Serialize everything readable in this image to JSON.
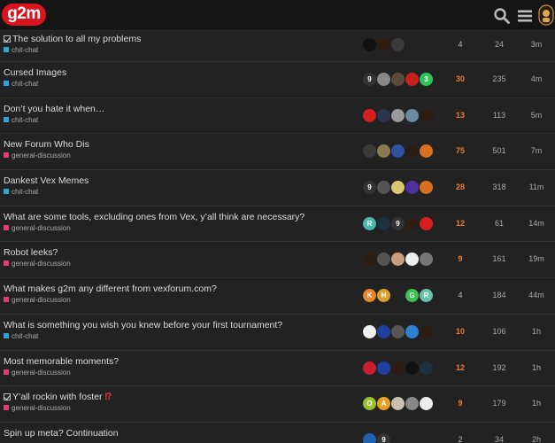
{
  "header": {
    "logo": "g2m",
    "icons": [
      "search-icon",
      "hamburger-menu-icon",
      "user-avatar"
    ]
  },
  "colors": {
    "chit_chat": "#2ea4d8",
    "general_discussion": "#e33a78",
    "hot_replies": "#f07c2e",
    "logo_red": "#d8141f"
  },
  "topics": [
    {
      "title": "The solution to all my problems",
      "pinned": true,
      "emoji": "",
      "category": "chit-chat",
      "cat_color": "#2ea4d8",
      "posters": [
        {
          "bg": "#111",
          "t": ""
        },
        {
          "bg": "#2b1d12",
          "t": ""
        },
        {
          "bg": "#3a3a3a",
          "t": ""
        }
      ],
      "replies": "4",
      "hot": false,
      "views": "24",
      "activity": "3m"
    },
    {
      "title": "Cursed Images",
      "pinned": false,
      "emoji": "",
      "category": "chit-chat",
      "cat_color": "#2ea4d8",
      "posters": [
        {
          "bg": "#333",
          "t": "9"
        },
        {
          "bg": "#888",
          "t": ""
        },
        {
          "bg": "#5b4a3a",
          "t": ""
        },
        {
          "bg": "#c82020",
          "t": ""
        },
        {
          "bg": "#2fc45a",
          "t": "3"
        }
      ],
      "replies": "30",
      "hot": true,
      "views": "235",
      "activity": "4m"
    },
    {
      "title": "Don’t you hate it when…",
      "pinned": false,
      "emoji": "",
      "category": "chit-chat",
      "cat_color": "#2ea4d8",
      "posters": [
        {
          "bg": "#d62020",
          "t": ""
        },
        {
          "bg": "#2a3550",
          "t": ""
        },
        {
          "bg": "#999",
          "t": ""
        },
        {
          "bg": "#6a8aa0",
          "t": ""
        },
        {
          "bg": "#2b1d12",
          "t": ""
        }
      ],
      "replies": "13",
      "hot": true,
      "views": "113",
      "activity": "5m"
    },
    {
      "title": "New Forum Who Dis",
      "pinned": false,
      "emoji": "",
      "category": "general-discussion",
      "cat_color": "#e33a78",
      "posters": [
        {
          "bg": "#3a3a3a",
          "t": ""
        },
        {
          "bg": "#8a7a50",
          "t": ""
        },
        {
          "bg": "#3050a0",
          "t": ""
        },
        {
          "bg": "#2b1d12",
          "t": ""
        },
        {
          "bg": "#d87020",
          "t": ""
        }
      ],
      "replies": "75",
      "hot": true,
      "views": "501",
      "activity": "7m"
    },
    {
      "title": "Dankest Vex Memes",
      "pinned": false,
      "emoji": "",
      "category": "chit-chat",
      "cat_color": "#2ea4d8",
      "posters": [
        {
          "bg": "#333",
          "t": "9"
        },
        {
          "bg": "#555",
          "t": ""
        },
        {
          "bg": "#d8c870",
          "t": ""
        },
        {
          "bg": "#5030a0",
          "t": ""
        },
        {
          "bg": "#d87020",
          "t": ""
        }
      ],
      "replies": "28",
      "hot": true,
      "views": "318",
      "activity": "11m"
    },
    {
      "title": "What are some tools, excluding ones from Vex, y’all think are necessary?",
      "pinned": false,
      "emoji": "",
      "category": "general-discussion",
      "cat_color": "#e33a78",
      "posters": [
        {
          "bg": "#4ab8a8",
          "t": "R"
        },
        {
          "bg": "#203040",
          "t": ""
        },
        {
          "bg": "#333",
          "t": "9"
        },
        {
          "bg": "#2b1d12",
          "t": ""
        },
        {
          "bg": "#d62020",
          "t": ""
        }
      ],
      "replies": "12",
      "hot": true,
      "views": "61",
      "activity": "14m"
    },
    {
      "title": "Robot leeks?",
      "pinned": false,
      "emoji": "",
      "category": "general-discussion",
      "cat_color": "#e33a78",
      "posters": [
        {
          "bg": "#2b1d12",
          "t": ""
        },
        {
          "bg": "#555",
          "t": ""
        },
        {
          "bg": "#c8a080",
          "t": ""
        },
        {
          "bg": "#eee",
          "t": ""
        },
        {
          "bg": "#777",
          "t": ""
        }
      ],
      "replies": "9",
      "hot": true,
      "views": "161",
      "activity": "19m"
    },
    {
      "title": "What makes g2m any different from vexforum.com?",
      "pinned": false,
      "emoji": "",
      "category": "general-discussion",
      "cat_color": "#e33a78",
      "posters": [
        {
          "bg": "#e8842a",
          "t": "K"
        },
        {
          "bg": "#d8a030",
          "t": "H"
        },
        {
          "bg": "#222",
          "t": ""
        },
        {
          "bg": "#3cc050",
          "t": "G"
        },
        {
          "bg": "#6ac0a8",
          "t": "R"
        }
      ],
      "replies": "4",
      "hot": false,
      "views": "184",
      "activity": "44m"
    },
    {
      "title": "What is something you wish you knew before your first tournament?",
      "pinned": false,
      "emoji": "",
      "category": "chit-chat",
      "cat_color": "#2ea4d8",
      "posters": [
        {
          "bg": "#eee",
          "t": ""
        },
        {
          "bg": "#2040a0",
          "t": ""
        },
        {
          "bg": "#555",
          "t": ""
        },
        {
          "bg": "#3080d0",
          "t": ""
        },
        {
          "bg": "#2b1d12",
          "t": ""
        }
      ],
      "replies": "10",
      "hot": true,
      "views": "106",
      "activity": "1h"
    },
    {
      "title": "Most memorable moments?",
      "pinned": false,
      "emoji": "",
      "category": "general-discussion",
      "cat_color": "#e33a78",
      "posters": [
        {
          "bg": "#c82030",
          "t": ""
        },
        {
          "bg": "#2040a0",
          "t": ""
        },
        {
          "bg": "#2b1d12",
          "t": ""
        },
        {
          "bg": "#111",
          "t": ""
        },
        {
          "bg": "#203040",
          "t": ""
        }
      ],
      "replies": "12",
      "hot": true,
      "views": "192",
      "activity": "1h"
    },
    {
      "title": "Y’all rockin with foster",
      "pinned": true,
      "emoji": "⁉",
      "category": "general-discussion",
      "cat_color": "#e33a78",
      "posters": [
        {
          "bg": "#9ac030",
          "t": "O"
        },
        {
          "bg": "#e8a020",
          "t": "A"
        },
        {
          "bg": "#c8c0b0",
          "t": ""
        },
        {
          "bg": "#888",
          "t": ""
        },
        {
          "bg": "#eee",
          "t": ""
        }
      ],
      "replies": "9",
      "hot": true,
      "views": "179",
      "activity": "1h"
    },
    {
      "title": "Spin up meta? Continuation",
      "pinned": false,
      "emoji": "",
      "category": "",
      "cat_color": "#e33a78",
      "posters": [
        {
          "bg": "#2060b0",
          "t": ""
        },
        {
          "bg": "#333",
          "t": "9"
        }
      ],
      "replies": "2",
      "hot": false,
      "views": "34",
      "activity": "2h"
    }
  ]
}
